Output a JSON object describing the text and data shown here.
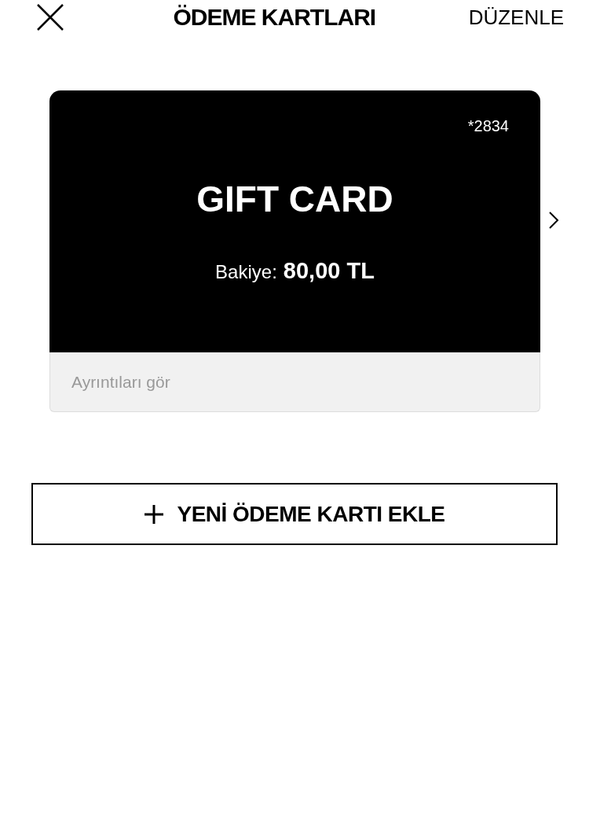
{
  "header": {
    "title": "ÖDEME KARTLARI",
    "action": "DÜZENLE"
  },
  "cards": [
    {
      "kind": "gift",
      "number": "*2834",
      "name": "GIFT CARD",
      "balance_label": "Bakiye:",
      "balance": "80,00 TL",
      "details_link": "Ayrıntıları gör"
    }
  ],
  "add_button": {
    "label": "YENİ ÖDEME KARTI EKLE"
  }
}
